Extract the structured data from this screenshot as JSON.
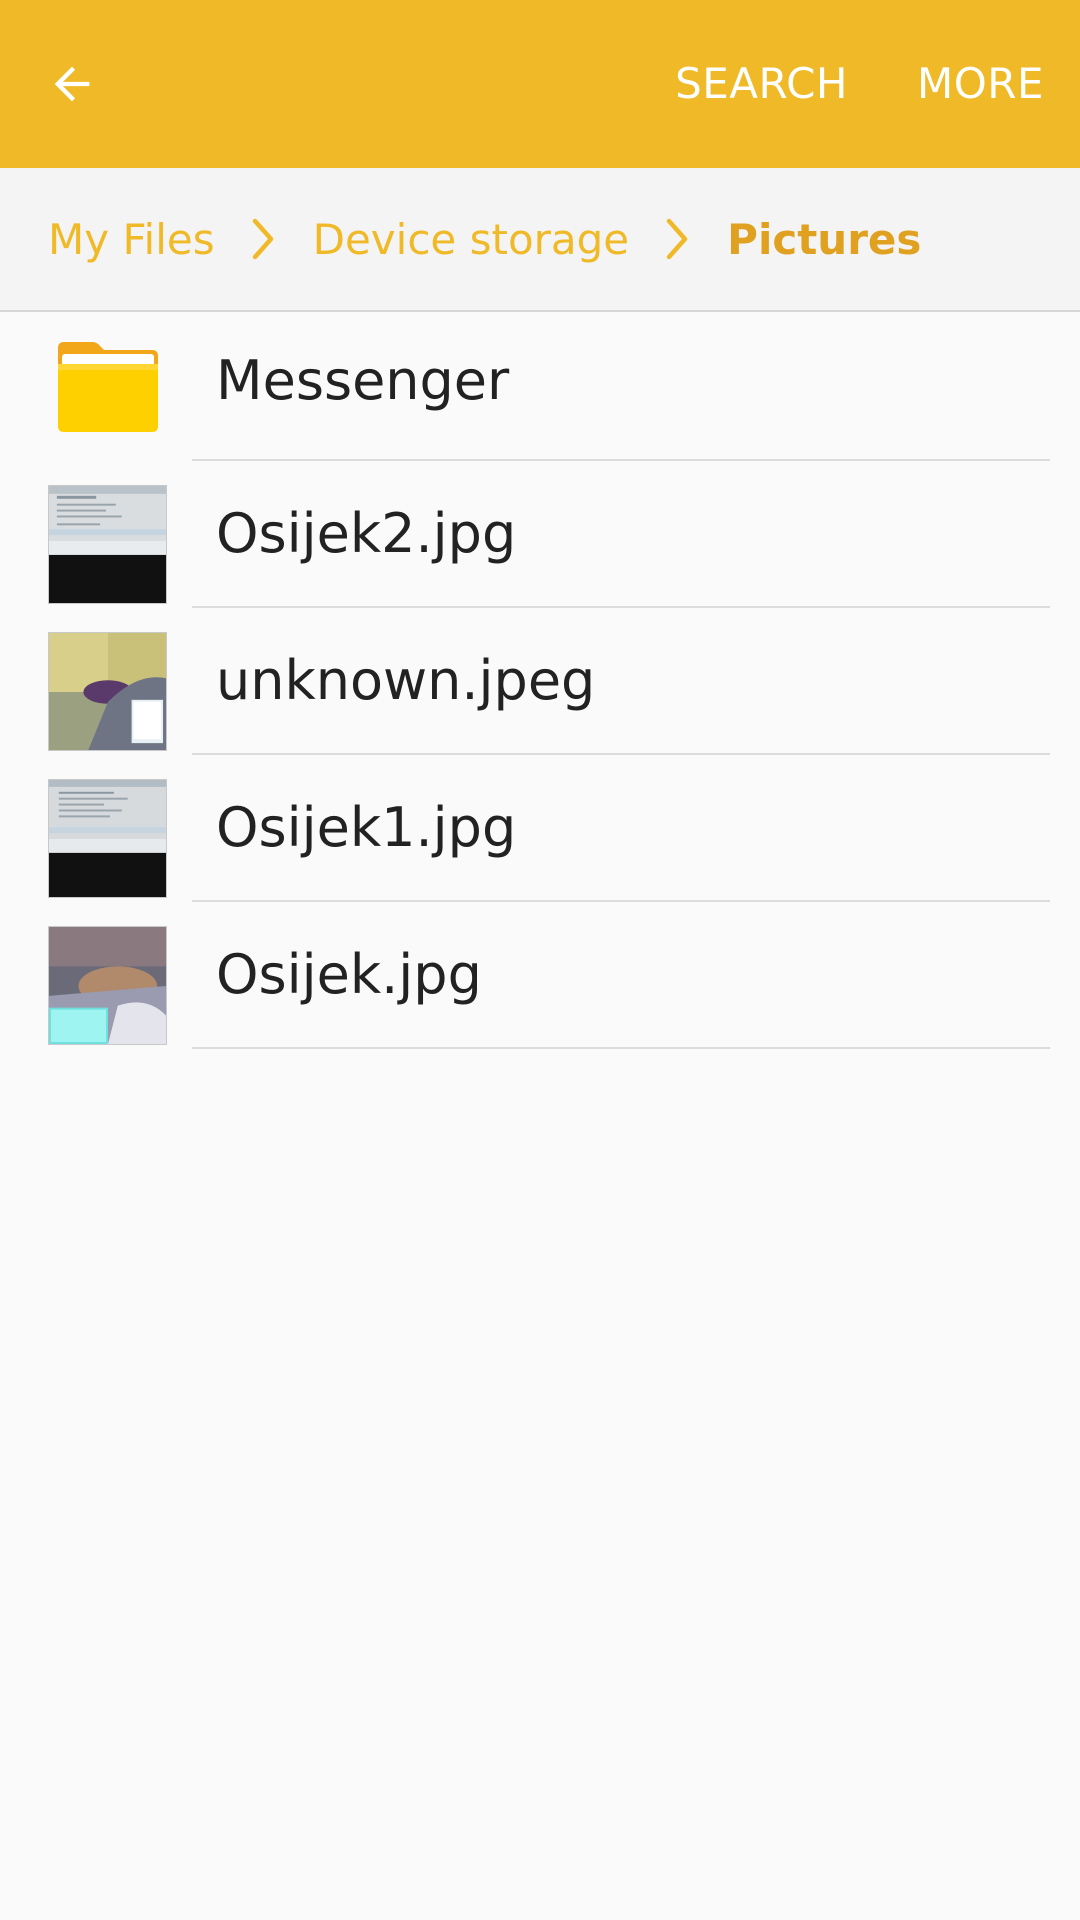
{
  "appbar": {
    "back_icon": "arrow-back-icon",
    "search_label": "SEARCH",
    "more_label": "MORE",
    "color": "#f0b927"
  },
  "breadcrumb": {
    "items": [
      {
        "label": "My Files"
      },
      {
        "label": "Device storage"
      },
      {
        "label": "Pictures"
      }
    ],
    "separator_icon": "chevron-right-icon"
  },
  "files": [
    {
      "name": "Messenger",
      "type": "folder",
      "icon": "folder-icon"
    },
    {
      "name": "Osijek2.jpg",
      "type": "image",
      "icon": "image-thumbnail"
    },
    {
      "name": "unknown.jpeg",
      "type": "image",
      "icon": "image-thumbnail"
    },
    {
      "name": "Osijek1.jpg",
      "type": "image",
      "icon": "image-thumbnail"
    },
    {
      "name": "Osijek.jpg",
      "type": "image",
      "icon": "image-thumbnail"
    }
  ]
}
